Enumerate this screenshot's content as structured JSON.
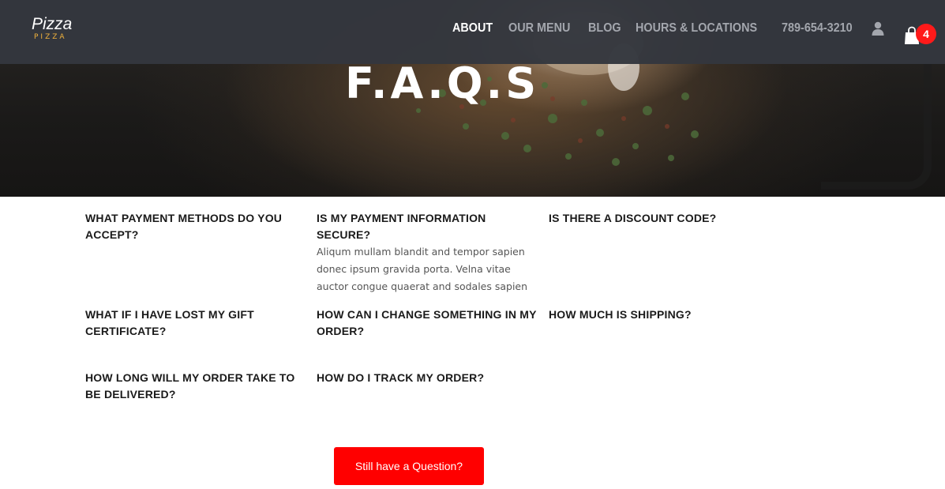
{
  "header": {
    "logo_main": "Pizza",
    "logo_sub": "PIZZA",
    "nav": [
      {
        "label": "ABOUT",
        "active": true
      },
      {
        "label": "OUR MENU",
        "active": false
      },
      {
        "label": "BLOG",
        "active": false
      },
      {
        "label": "HOURS & LOCATIONS",
        "active": false
      }
    ],
    "phone": "789-654-3210",
    "user_icon": "user-icon",
    "cart_icon": "shopping-bag-icon",
    "cart_count": "4"
  },
  "hero": {
    "title": "F.A.Q.S"
  },
  "faqs": [
    {
      "question": "What payment methods do you accept?",
      "answer": ""
    },
    {
      "question": "Is my payment information secure?",
      "answer": "Aliqum mullam blandit and tempor sapien donec ipsum gravida porta. Velna vitae auctor congue quaerat and sodales sapien"
    },
    {
      "question": "Is there a discount code?",
      "answer": ""
    },
    {
      "question": "What if I have lost my gift certificate?",
      "answer": ""
    },
    {
      "question": "How can I change something in my order?",
      "answer": ""
    },
    {
      "question": "How much is shipping?",
      "answer": ""
    },
    {
      "question": "How long will my order take to be delivered?",
      "answer": ""
    },
    {
      "question": "How do I track my order?",
      "answer": ""
    }
  ],
  "cta": {
    "label": "Still have a Question?"
  },
  "colors": {
    "nav_bar": "#34373e",
    "accent_red": "#ff0000",
    "logo_sub": "#f2b33d"
  }
}
